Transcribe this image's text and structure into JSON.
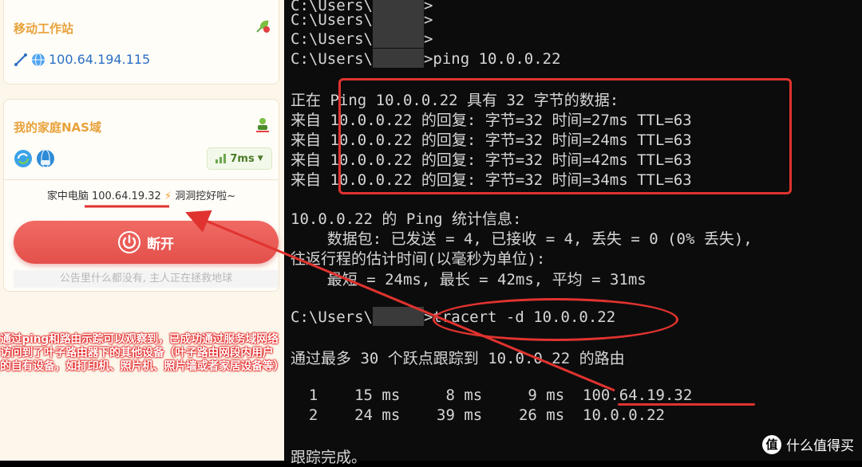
{
  "app": {
    "workstation": {
      "title": "移动工作站",
      "ip": "100.64.194.115"
    },
    "nas": {
      "title": "我的家庭NAS域",
      "ping": "7ms",
      "device_label": "家中电脑",
      "device_ip": "100.64.19.32",
      "device_status": "洞洞挖好啦~",
      "disconnect_label": "断开",
      "notice": "公告里什么都没有, 主人正在拯救地球"
    },
    "annotation": "通过ping和路由示踪可以观察到，已成功通过服务域网络访问到了叶子路由器下的其他设备（叶子路由网段内用户的自有设备，如打印机、照片机、照片墙或者家居设备等）"
  },
  "terminal": {
    "lines": [
      "C:\\Users\\",
      "C:\\Users\\",
      "C:\\Users\\",
      "C:\\Users\\",
      "",
      "正在 Ping 10.0.0.22 具有 32 字节的数据:",
      "来自 10.0.0.22 的回复: 字节=32 时间=27ms TTL=63",
      "来自 10.0.0.22 的回复: 字节=32 时间=24ms TTL=63",
      "来自 10.0.0.22 的回复: 字节=32 时间=42ms TTL=63",
      "来自 10.0.0.22 的回复: 字节=32 时间=34ms TTL=63",
      "",
      "10.0.0.22 的 Ping 统计信息:",
      "    数据包: 已发送 = 4, 已接收 = 4, 丢失 = 0 (0% 丢失),",
      "往返行程的估计时间(以毫秒为单位):",
      "    最短 = 24ms, 最长 = 42ms, 平均 = 31ms",
      "",
      "C:\\Users\\",
      "",
      "通过最多 30 个跃点跟踪到 10.0.0.22 的路由",
      "",
      "  1    15 ms     8 ms     9 ms  100.64.19.32",
      "  2    24 ms    39 ms    26 ms  10.0.0.22",
      "",
      "跟踪完成。"
    ],
    "suffix_0": ">",
    "suffix_1": ">",
    "suffix_2": ">",
    "suffix_3": ">ping 10.0.0.22",
    "suffix_16": ">tracert -d 10.0.0.22",
    "watermark": "什么值得买"
  },
  "colors": {
    "accent": "#e8a23a",
    "link": "#2b6fc4",
    "danger": "#e0332f",
    "button": "#e4504b"
  }
}
